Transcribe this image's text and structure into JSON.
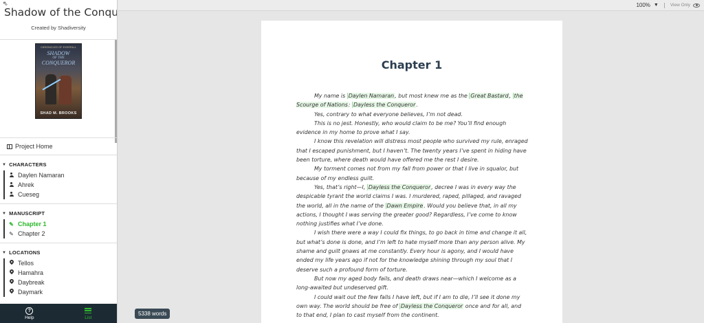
{
  "project": {
    "title": "Shadow of the Conqueror",
    "creator": "Created by Shadiversity"
  },
  "cover": {
    "series": "CHRONICLES OF EVERFALL",
    "title_line1": "SHADOW",
    "title_line2": "OF THE",
    "title_line3": "CONQUEROR",
    "author": "SHAD M. BROOKS"
  },
  "sidebar": {
    "project_home": "Project Home",
    "characters": {
      "heading": "CHARACTERS",
      "items": [
        "Daylen Namaran",
        "Ahrek",
        "Cueseg"
      ]
    },
    "manuscript": {
      "heading": "MANUSCRIPT",
      "items": [
        "Chapter 1",
        "Chapter 2"
      ]
    },
    "locations": {
      "heading": "LOCATIONS",
      "items": [
        "Tellos",
        "Hamahra",
        "Daybreak",
        "Daymark"
      ]
    }
  },
  "bottom_bar": {
    "help": "Help",
    "list": "List"
  },
  "topbar": {
    "zoom": "100%",
    "view_only": "View Only"
  },
  "chapter": {
    "title": "Chapter 1",
    "links": [
      "Daylen Namaran",
      "Great Bastard",
      "the Scourge of Nations",
      "Dayless the Conqueror",
      "Dawn Empire"
    ]
  },
  "word_count": "5338 words",
  "colors": {
    "accent": "#2eb82e",
    "bottom_bar": "#1c2b33",
    "highlight": "#e6f7e6"
  }
}
